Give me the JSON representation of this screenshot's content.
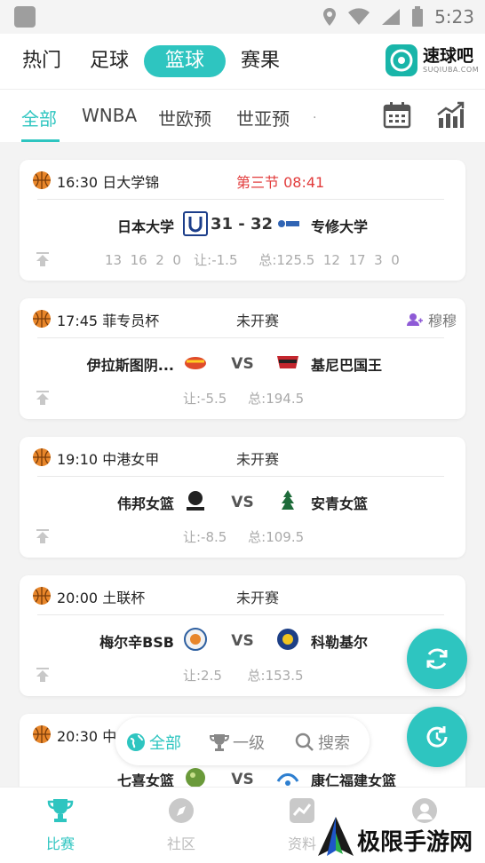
{
  "status_bar": {
    "time": "5:23"
  },
  "header": {
    "tabs": [
      {
        "label": "热门"
      },
      {
        "label": "足球"
      },
      {
        "label": "篮球"
      },
      {
        "label": "赛果"
      }
    ],
    "active_tab": "篮球",
    "logo": {
      "name": "速球吧",
      "sub": "SUQIUBA.COM"
    }
  },
  "subtabs": {
    "items": [
      {
        "label": "全部"
      },
      {
        "label": "WNBA"
      },
      {
        "label": "世欧预"
      },
      {
        "label": "世亚预"
      }
    ],
    "more": ".",
    "active": "全部",
    "icons": [
      "calendar-icon",
      "trend-chart-icon"
    ]
  },
  "matches": [
    {
      "time_league": "16:30 日大学锦",
      "status": "第三节  08:41",
      "live": true,
      "home": "日本大学",
      "away": "专修大学",
      "score": "31 - 32",
      "stats": "13  16  2  0   让:-1.5     总:125.5  12  17  3  0"
    },
    {
      "time_league": "17:45 菲专员杯",
      "status": "未开赛",
      "live": false,
      "home": "伊拉斯图阴...",
      "away": "基尼巴国王",
      "vs": "VS",
      "odds": "让:-5.5     总:194.5",
      "fav": "穆穆"
    },
    {
      "time_league": "19:10 中港女甲",
      "status": "未开赛",
      "live": false,
      "home": "伟邦女篮",
      "away": "安青女篮",
      "vs": "VS",
      "odds": "让:-8.5     总:109.5"
    },
    {
      "time_league": "20:00 土联杯",
      "status": "未开赛",
      "live": false,
      "home": "梅尔辛BSB",
      "away": "科勒基尔",
      "vs": "VS",
      "odds": "让:2.5      总:153.5"
    },
    {
      "time_league": "20:30 中",
      "status": "",
      "live": false,
      "home": "七喜女篮",
      "away": "康仁福建女篮",
      "vs": "VS"
    }
  ],
  "filter": {
    "items": [
      {
        "label": "全部",
        "icon": "globe-icon"
      },
      {
        "label": "一级",
        "icon": "trophy-icon"
      },
      {
        "label": "搜索",
        "icon": "search-icon"
      }
    ]
  },
  "bottom_nav": {
    "items": [
      {
        "label": "比赛",
        "icon": "trophy-icon"
      },
      {
        "label": "社区",
        "icon": "compass-icon"
      },
      {
        "label": "资料",
        "icon": "chart-icon"
      },
      {
        "label": "",
        "icon": "profile-icon"
      }
    ],
    "active": "比赛"
  },
  "colors": {
    "accent": "#2ec5c0",
    "live": "#e23c3c"
  },
  "watermark": {
    "text": "极限手游网"
  }
}
